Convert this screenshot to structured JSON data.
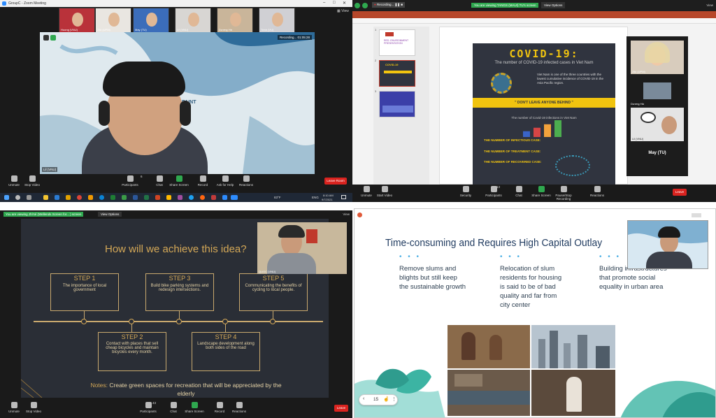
{
  "q1": {
    "window_title": "GroupC - Zoom Meeting",
    "view_label": "View",
    "participants": [
      {
        "name": "Huong (VNU)",
        "bg": "#b9323a"
      },
      {
        "name": "Ziki (UPM)",
        "bg": "#e9e6e1"
      },
      {
        "name": "May (TU)",
        "bg": "#3b6dba"
      },
      {
        "name": "Lil (VNU)",
        "bg": "#d8d6d3"
      },
      {
        "name": "Dương Hà",
        "bg": "#c9b59a"
      },
      {
        "name": "Trinh (VU)",
        "bg": "#d0d0d4"
      }
    ],
    "speaker_name": "Lil (VNU)",
    "recording_text": "Recording... 01:05:28",
    "wall_text": "D PAINT",
    "toolbar": [
      {
        "label": "Unmute"
      },
      {
        "label": "Stop Video"
      },
      {
        "label": "Participants"
      },
      {
        "label": "Chat"
      },
      {
        "label": "Share Screen"
      },
      {
        "label": "Record"
      },
      {
        "label": "Ask for Help"
      },
      {
        "label": "Reactions"
      }
    ],
    "participants_count": "6",
    "leave_label": "Leave Room",
    "tray": {
      "temp": "83°F",
      "lang": "ENG",
      "time": "8:10 AM",
      "date": "9/7/2021"
    }
  },
  "q2": {
    "banner": "You are viewing TANGS (MAUI) TU's screen",
    "view_options": "View Options",
    "view_label": "View",
    "recording": "Recording...",
    "slides": [
      {
        "num": "1",
        "title": "RED. ENVIRONMENT PRESENTATION"
      },
      {
        "num": "2",
        "title": "COVID-19"
      },
      {
        "num": "3",
        "title": ""
      }
    ],
    "poster_title": "COVID-19:",
    "poster_subtitle": "The number of COVID-19 infected cases in Viet Nam",
    "poster_para": "Viet Nam is one of the three countries with the lowest cumulative incidence of COVID-19 in the Asia Pacific region.",
    "poster_banner": "\" DON'T LEAVE ANYONE BEHIND \"",
    "poster_chart_title": "The number of Covid-19 infections in Viet Nam",
    "poster_lines": [
      "THE NUMBER OF INFECTIOUS CASE:",
      "THE NUMBER OF TREATMENT CASE:",
      "THE NUMBER OF RECOVERED CASE:"
    ],
    "bar_values": [
      1,
      1.6,
      2.2,
      2.9
    ],
    "bar_colors": [
      "#3a64c8",
      "#d64545",
      "#f2a23c",
      "#4cae4f"
    ],
    "side_names": [
      {
        "name": "Ziki (UPM)"
      },
      {
        "name": "Dương Hà"
      },
      {
        "name": "Lil (VNU)"
      }
    ],
    "may_label": "May (TU)",
    "toolbar": [
      {
        "label": "Unmute"
      },
      {
        "label": "Start Video"
      },
      {
        "label": "Security"
      },
      {
        "label": "Participants"
      },
      {
        "label": "Chat"
      },
      {
        "label": "Share Screen"
      },
      {
        "label": "Pause/Stop Recording"
      },
      {
        "label": "Reactions"
      }
    ],
    "participants_count": "13",
    "leave_label": "Leave"
  },
  "q3": {
    "banner": "You are viewing Jhi'sé (Wellends Screen for... ) screen",
    "view_options": "View Options",
    "view_label": "View",
    "title": "How will we achieve this idea?",
    "cam_name": "QUOC (VNU)",
    "steps": [
      {
        "head": "STEP 1",
        "body": "The importance of local government"
      },
      {
        "head": "STEP 3",
        "body": "Build bike parking systems and redesign intersections."
      },
      {
        "head": "STEP 5",
        "body": "Communicating the benefits of cycling to local people."
      },
      {
        "head": "STEP 2",
        "body": "Contact with places that sell cheap bicycles and maintain bicycles every month."
      },
      {
        "head": "STEP 4",
        "body": "Landscape development along both sides of the road"
      }
    ],
    "notes_label": "Notes:",
    "notes_text": " Create green spaces for recreation that will be appreciated by the elderly",
    "toolbar": [
      {
        "label": "Unmute"
      },
      {
        "label": "Stop Video"
      },
      {
        "label": "Participants"
      },
      {
        "label": "Chat"
      },
      {
        "label": "Share Screen"
      },
      {
        "label": "Record"
      },
      {
        "label": "Reactions"
      }
    ],
    "participants_count": "43",
    "leave_label": "Leave"
  },
  "q4": {
    "title": "Time-consuming and Requires High Capital Outlay",
    "columns": [
      "Remove slums and blights but still keep the sustainable growth",
      "Relocation of slum residents for housing is said to be of bad quality and far from city center",
      "Building infrastructures that promote social equality in urban area"
    ],
    "dots": "• • •",
    "page_number": "15",
    "colors": {
      "title": "#1f3a5f",
      "accent": "#4fb1e5",
      "leaf": "#3cb4a3"
    }
  }
}
